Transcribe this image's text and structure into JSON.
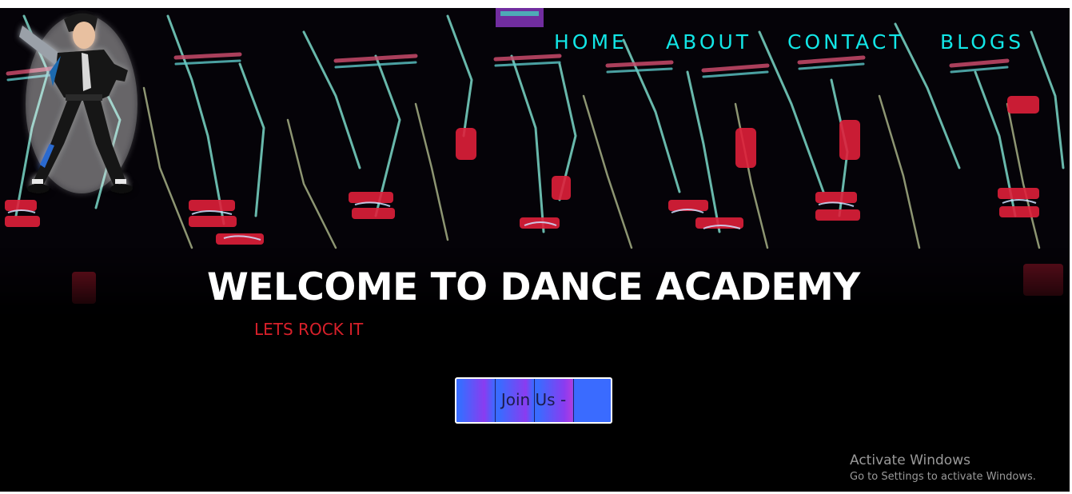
{
  "nav": {
    "items": [
      {
        "label": "HOME"
      },
      {
        "label": "ABOUT"
      },
      {
        "label": "CONTACT"
      },
      {
        "label": "BLOGS"
      }
    ]
  },
  "hero": {
    "title": "WELCOME TO DANCE ACADEMY",
    "subtitle": "LETS ROCK IT",
    "cta_label": "Join Us -",
    "background_image": "dancers-in-led-light-suits",
    "logo_image": "cartoon-dancer-mascot"
  },
  "watermark": {
    "title": "Activate Windows",
    "subtitle": "Go to Settings to activate Windows."
  },
  "colors": {
    "nav_link": "#12e6e6",
    "title": "#ffffff",
    "subtitle": "#d8202a",
    "button_blue": "#3a6bff",
    "button_purple": "#8a3cf0",
    "background": "#000000"
  }
}
